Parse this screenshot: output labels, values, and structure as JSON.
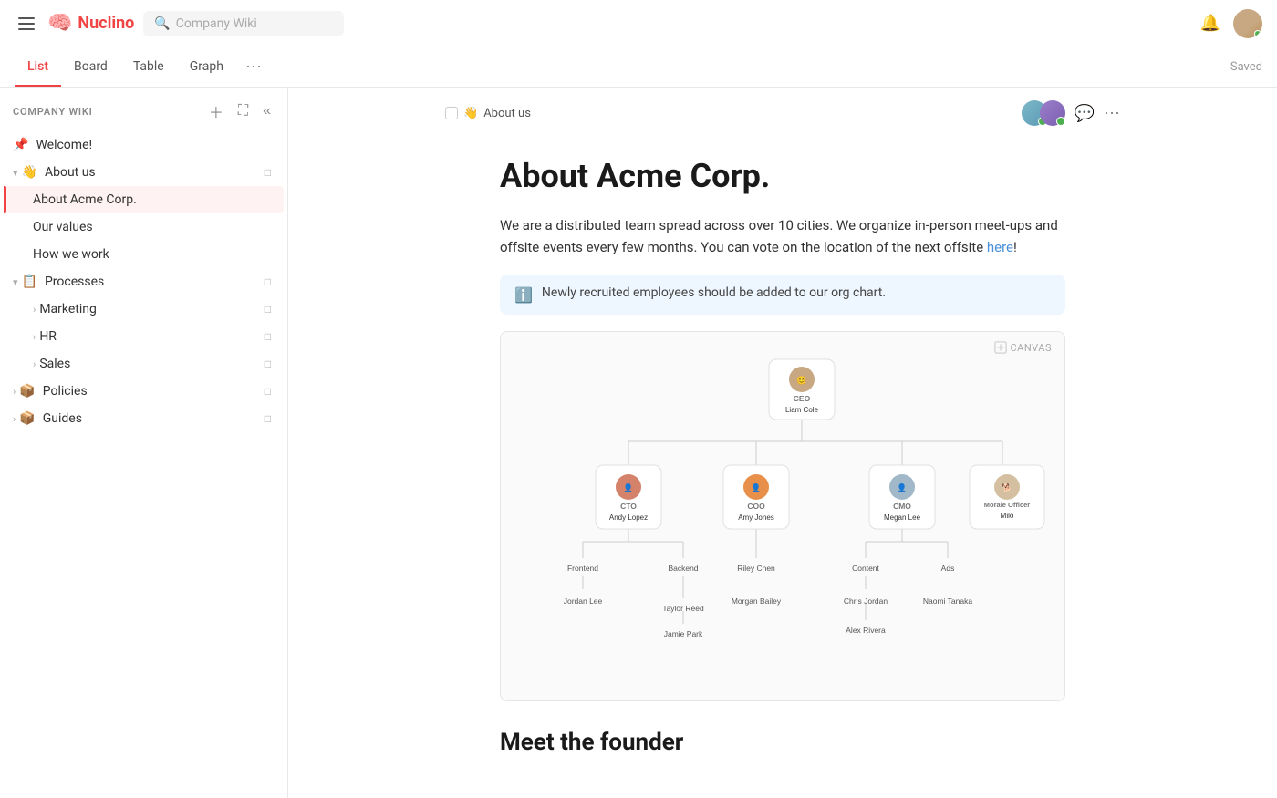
{
  "app": {
    "name": "Nuclino",
    "search_placeholder": "Company Wiki"
  },
  "tabs": [
    {
      "id": "list",
      "label": "List",
      "active": true
    },
    {
      "id": "board",
      "label": "Board",
      "active": false
    },
    {
      "id": "table",
      "label": "Table",
      "active": false
    },
    {
      "id": "graph",
      "label": "Graph",
      "active": false
    }
  ],
  "saved_label": "Saved",
  "sidebar": {
    "title": "COMPANY WIKI",
    "items": [
      {
        "id": "welcome",
        "label": "Welcome!",
        "icon": "📌",
        "indent": 0,
        "pinned": true
      },
      {
        "id": "about-us",
        "label": "About us",
        "icon": "👋",
        "indent": 0,
        "expanded": true
      },
      {
        "id": "about-acme",
        "label": "About Acme Corp.",
        "indent": 1,
        "active": true
      },
      {
        "id": "our-values",
        "label": "Our values",
        "indent": 1
      },
      {
        "id": "how-we-work",
        "label": "How we work",
        "indent": 1
      },
      {
        "id": "processes",
        "label": "Processes",
        "icon": "📋",
        "indent": 0,
        "expanded": true
      },
      {
        "id": "marketing",
        "label": "Marketing",
        "indent": 1,
        "has_arrow": true
      },
      {
        "id": "hr",
        "label": "HR",
        "indent": 1,
        "has_arrow": true
      },
      {
        "id": "sales",
        "label": "Sales",
        "indent": 1,
        "has_arrow": true
      },
      {
        "id": "policies",
        "label": "Policies",
        "icon": "📦",
        "indent": 0,
        "has_arrow": true
      },
      {
        "id": "guides",
        "label": "Guides",
        "icon": "📦",
        "indent": 0,
        "has_arrow": true
      }
    ]
  },
  "breadcrumb": {
    "icon": "👋",
    "text": "About us"
  },
  "page": {
    "title": "About Acme Corp.",
    "body_1": "We are a distributed team spread across over 10 cities. We organize in-person meet-ups and offsite events every few months. You can vote on the location of the next offsite ",
    "link_text": "here",
    "body_2": "!",
    "info_box": "Newly recruited employees should be added to our org chart.",
    "canvas_label": "CANVAS",
    "section2_title": "Meet the founder"
  },
  "org_chart": {
    "ceo": {
      "role": "CEO",
      "name": "Liam Cole"
    },
    "cto": {
      "role": "CTO",
      "name": "Andy Lopez"
    },
    "coo": {
      "role": "COO",
      "name": "Amy Jones"
    },
    "cmo": {
      "role": "CMO",
      "name": "Megan Lee"
    },
    "morale": {
      "role": "Morale Officer",
      "name": "Milo"
    },
    "frontend": "Frontend",
    "backend": "Backend",
    "riley": "Riley Chen",
    "content": "Content",
    "ads": "Ads",
    "jordan": "Jordan Lee",
    "taylor": "Taylor Reed",
    "morgan": "Morgan Bailey",
    "chris": "Chris Jordan",
    "naomi": "Naomi Tanaka",
    "jamie": "Jamie Park",
    "alex": "Alex Rivera"
  }
}
